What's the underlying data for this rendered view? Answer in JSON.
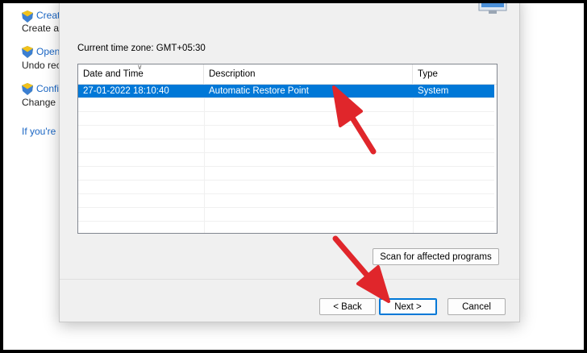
{
  "background": {
    "items": [
      {
        "link": "Create",
        "desc": "Create a"
      },
      {
        "link": "Open",
        "desc": "Undo rec"
      },
      {
        "link": "Confi",
        "desc": "Change r"
      }
    ],
    "footer_link": "If you're"
  },
  "dialog": {
    "timezone_label": "Current time zone: GMT+05:30",
    "columns": [
      "Date and Time",
      "Description",
      "Type"
    ],
    "rows": [
      {
        "date": "27-01-2022 18:10:40",
        "description": "Automatic Restore Point",
        "type": "System",
        "selected": true
      }
    ],
    "scan_button": "Scan for affected programs",
    "back_button": "< Back",
    "next_button": "Next >",
    "cancel_button": "Cancel"
  },
  "colors": {
    "selection": "#0078d7",
    "arrow": "#e0262b",
    "link": "#1a66c4"
  }
}
